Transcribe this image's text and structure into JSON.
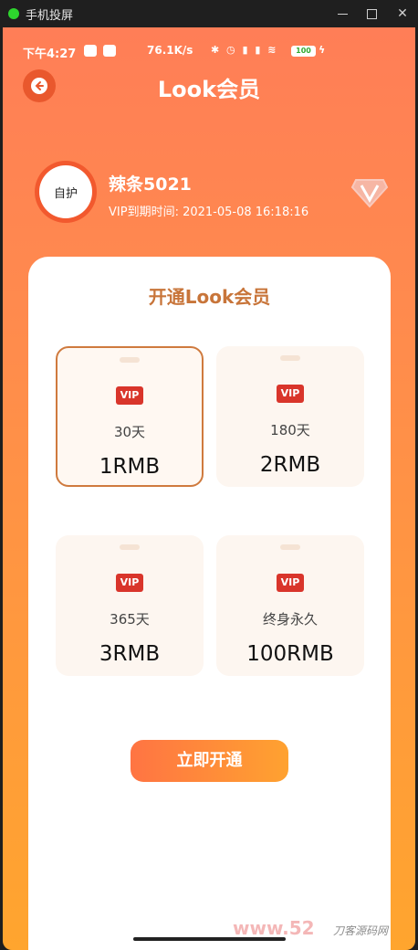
{
  "window": {
    "title": "手机投屏"
  },
  "status_bar": {
    "time": "下午4:27",
    "net_speed": "76.1K/s",
    "battery": "100"
  },
  "header": {
    "title": "Look会员"
  },
  "user": {
    "avatar_text": "自护",
    "name": "辣条5021",
    "vip_expiry": "VIP到期时间: 2021-05-08 16:18:16"
  },
  "membership": {
    "title": "开通Look会员",
    "badge_label": "VIP",
    "plans": [
      {
        "duration": "30天",
        "price": "1RMB",
        "selected": true
      },
      {
        "duration": "180天",
        "price": "2RMB",
        "selected": false
      },
      {
        "duration": "365天",
        "price": "3RMB",
        "selected": false
      },
      {
        "duration": "终身永久",
        "price": "100RMB",
        "selected": false
      }
    ],
    "cta_label": "立即开通"
  },
  "watermark": {
    "text": "www.52",
    "logo": "刀客源码网"
  },
  "colors": {
    "accent": "#ff7e57",
    "selected_border": "#cf7a3e",
    "vip_badge": "#d9352b",
    "title_text": "#c8753a"
  }
}
